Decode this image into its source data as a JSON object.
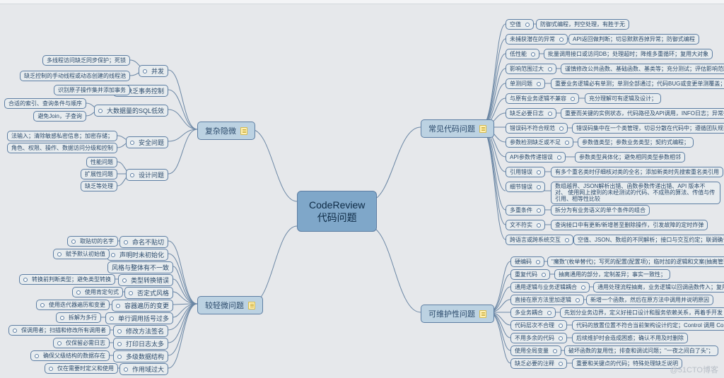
{
  "center": {
    "line1": "CodeReview",
    "line2": "代码问题"
  },
  "watermark": "@51CTO博客",
  "left_cats": {
    "complex": {
      "label": "复杂隐微"
    },
    "minor": {
      "label": "较轻微问题"
    }
  },
  "right_cats": {
    "common": {
      "label": "常见代码问题"
    },
    "maintain": {
      "label": "可维护性问题"
    }
  },
  "complex_subs": {
    "concurrency": "并发",
    "transaction": "缺乏事务控制",
    "sql": "大数据量的SQL低效",
    "safety": "安全问题",
    "design": "设计问题"
  },
  "complex_leaves": {
    "c1": "多线程访问缺乏同步保护；死锁",
    "c2": "缺乏控制的手动线程或动态创建的线程池",
    "tr1": "识别原子操作集并添加事务",
    "sql1": "合适的索引、查询条件与顺序",
    "sql2": "避免Join，子查询",
    "sf1": "法输入；清除敏感私密信息；加密存储；",
    "sf2": "角色、权限、操作、数据访问分级和控制",
    "d1": "性能问题",
    "d2": "扩展性问题",
    "d3": "缺乏等处理"
  },
  "minor_subs": {
    "naming": "命名不贴切",
    "init": "声明时未初始化",
    "style": "风格与整体有不一致",
    "typecv": "类型转换错误",
    "neg": "否定式风格",
    "iter": "容器遍历的变更",
    "line": "单行调用括号过多",
    "sig": "修改方法签名",
    "log": "打印日志太多",
    "dup": "多级数据结构",
    "scope": "作用域过大"
  },
  "minor_leaves": {
    "m1": "取贴切的名字",
    "m2": "赋予默认初始值",
    "m3": "转换前判断类型；避免类型转换",
    "m4": "使用肯定句式",
    "m5": "使用迭代器遍历和变更",
    "m6": "拆解为多行",
    "m7": "保调用者；扫描和修改所有调用者",
    "m8": "仅保留必需日志",
    "m9": "确保父级结构的数据存在",
    "m10": "仅在需要时定义和使用"
  },
  "common": {
    "r1": {
      "a": "空值",
      "b": "防御式编程，判空处理，有胜于无"
    },
    "r2": {
      "a": "未捕获潜在的异常",
      "b": "API返回做判断；切忌默默吞掉异常；防御式编程"
    },
    "r3": {
      "a": "低性能",
      "b": "批量调用接口或访问DB；处理超时；降维多重循环；复用大对象"
    },
    "r4": {
      "a": "影响范围过大",
      "b": "谨慎修改公共函数、基础函数、基类等；充分测试；评估影响范围"
    },
    "r5": {
      "a": "单测问题",
      "b": "重要业务逻辑必有单测；单测全部通过；代码BUG或变更单测覆盖；增加异常单测"
    },
    "r6": {
      "a": "与原有业务逻辑不兼容",
      "b": "充分理解可有逻辑及设计；"
    },
    "r7": {
      "a": "缺乏必要日志",
      "b": "重要而关键的实例状态，代码路径及API调用，INFO日志；异常捕获并Error日"
    },
    "r8": {
      "a": "错误码不符合规范",
      "b": "错误码集中在一个类管理，切忌分散在代码中；遵循团队规范"
    },
    "r9": {
      "a": "参数检测缺乏或不足",
      "b": "参数值类型；参数业务类型；契约式编程；"
    },
    "r10": {
      "a": "API参数传递错误",
      "b": "参数类型具体化；避免相同类型参数相邻"
    },
    "r11": {
      "a": "引用错误",
      "b": "有多个重名类时仔细核对类的全名；添加新类时先搜索重名类引用"
    },
    "r12": {
      "a": "细节错误",
      "b": "数组越界、JSON解析出错、函数参数传递出错、API 版本不对、\n使用网上搜到的未经测试的代码、不成熟的算法、传值与传引用、相等性比较"
    },
    "r13": {
      "a": "多重条件",
      "b": "拆分为有业务语义的单个条件的组合"
    },
    "r14": {
      "a": "文不符实",
      "b": "查询接口中有更新/新增甚至删除操作，引发故障的定时炸弹"
    },
    "r15": {
      "a": "跨语言或跨系统交互",
      "b": "空值、JSON、数组的不同解析；接口与交互约定；联调确认"
    }
  },
  "maintain": {
    "v1": {
      "a": "硬编码",
      "b": "\"魔数\"(枚举替代)；写死的配置(配置项)；临时加的逻辑和文案(抽离管理)"
    },
    "v2": {
      "a": "重复代码",
      "b": "抽离通用的部分，定制差异；事实一致性；"
    },
    "v3": {
      "a": "通用逻辑与业务逻辑耦合",
      "b": "通用处理流程抽离，业务逻辑以回调函数传入；复用而非混杂"
    },
    "v4": {
      "a": "直接在原方法里加逻辑",
      "b": "新增一个函数，然后在原方法中调用并说明原因"
    },
    "v5": {
      "a": "多业务耦合",
      "b": "先划分业务边界，定义好接口设计和服务依赖关系，再着手开发"
    },
    "v6": {
      "a": "代码层次不合理",
      "b": "代码的放置位置不符合当前架构设计约定；Control 调用 Control；"
    },
    "v7": {
      "a": "不用多余的代码",
      "b": "后续维护时会造成困惑；确认不用及时删除"
    },
    "v8": {
      "a": "使用全局变量",
      "b": "破坏函数的复用性；排查和调试问题；\"一夜之间白了头\"；"
    },
    "v9": {
      "a": "缺乏必要的注释",
      "b": "重要和关键点的代码；特殊处理缺乏说明"
    }
  }
}
